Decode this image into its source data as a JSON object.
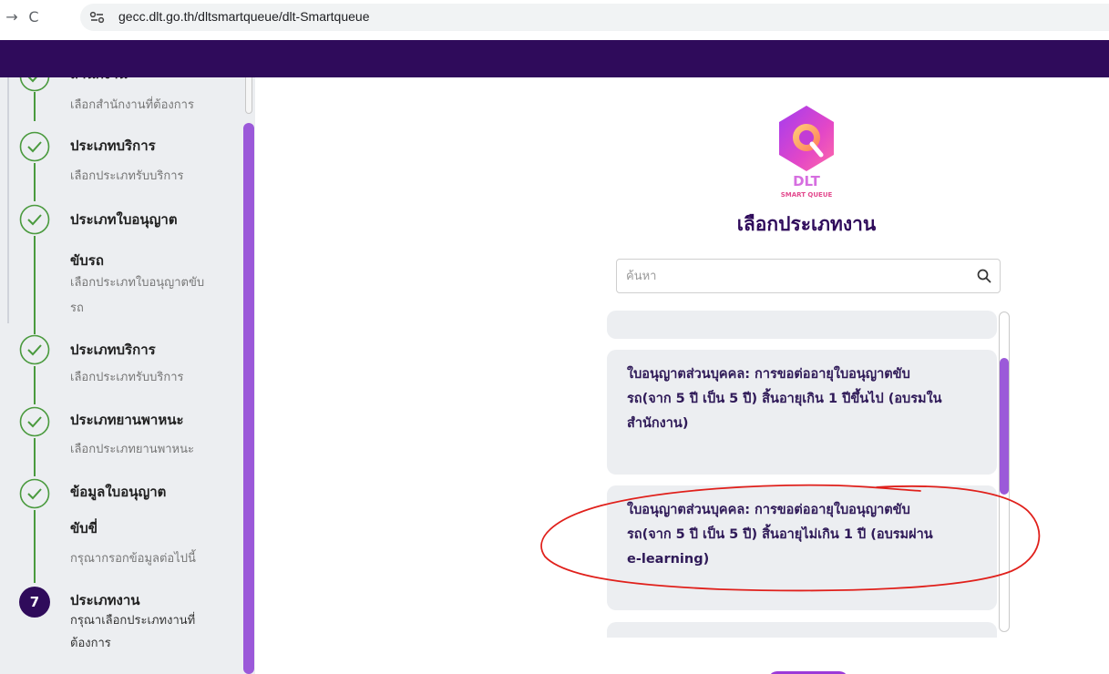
{
  "browser": {
    "url": "gecc.dlt.go.th/dltsmartqueue/dlt-Smartqueue",
    "forward_glyph": "→",
    "reload_glyph": "C"
  },
  "sidebar": {
    "partial_top_title": "สำนักงาน",
    "partial_top_sub": "เลือกสำนักงานที่ต้องการ",
    "steps": [
      {
        "title": "ประเภทบริการ",
        "sub": "เลือกประเภทรับบริการ",
        "status": "done"
      },
      {
        "title_line1": "ประเภทใบอนุญาต",
        "title_line2": "ขับรถ",
        "sub_line1": "เลือกประเภทใบอนุญาตขับ",
        "sub_line2": "รถ",
        "status": "done"
      },
      {
        "title": "ประเภทบริการ",
        "sub": "เลือกประเภทรับบริการ",
        "status": "done"
      },
      {
        "title": "ประเภทยานพาหนะ",
        "sub": "เลือกประเภทยานพาหนะ",
        "status": "done"
      },
      {
        "title_line1": "ข้อมูลใบอนุญาต",
        "title_line2": "ขับขี่",
        "sub": "กรุณากรอกข้อมูลต่อไปนี้",
        "status": "done"
      },
      {
        "number": "7",
        "title": "ประเภทงาน",
        "sub_line1": "กรุณาเลือกประเภทงานที่",
        "sub_line2": "ต้องการ",
        "status": "current"
      }
    ]
  },
  "main": {
    "logo_text": "DLT",
    "logo_sub": "SMART QUEUE",
    "title": "เลือกประเภทงาน",
    "search_placeholder": "ค้นหา",
    "work_types": [
      {
        "line1": "ใบอนุญาตส่วนบุคคล: การขอต่ออายุใบอนุญาตขับ",
        "line2": "รถ(จาก 5 ปี เป็น 5 ปี) สิ้นอายุเกิน 1 ปีขึ้นไป (อบรมใน",
        "line3": "สำนักงาน)"
      },
      {
        "line1": "ใบอนุญาตส่วนบุคคล: การขอต่ออายุใบอนุญาตขับ",
        "line2": "รถ(จาก 5 ปี เป็น 5 ปี) สิ้นอายุไม่เกิน 1 ปี (อบรมผ่าน",
        "line3": "e-learning)"
      }
    ]
  },
  "colors": {
    "header_purple": "#2f0b5b",
    "accent_purple": "#9b59d9",
    "check_green": "#4a9a3e",
    "annotation_red": "#e0201b"
  }
}
